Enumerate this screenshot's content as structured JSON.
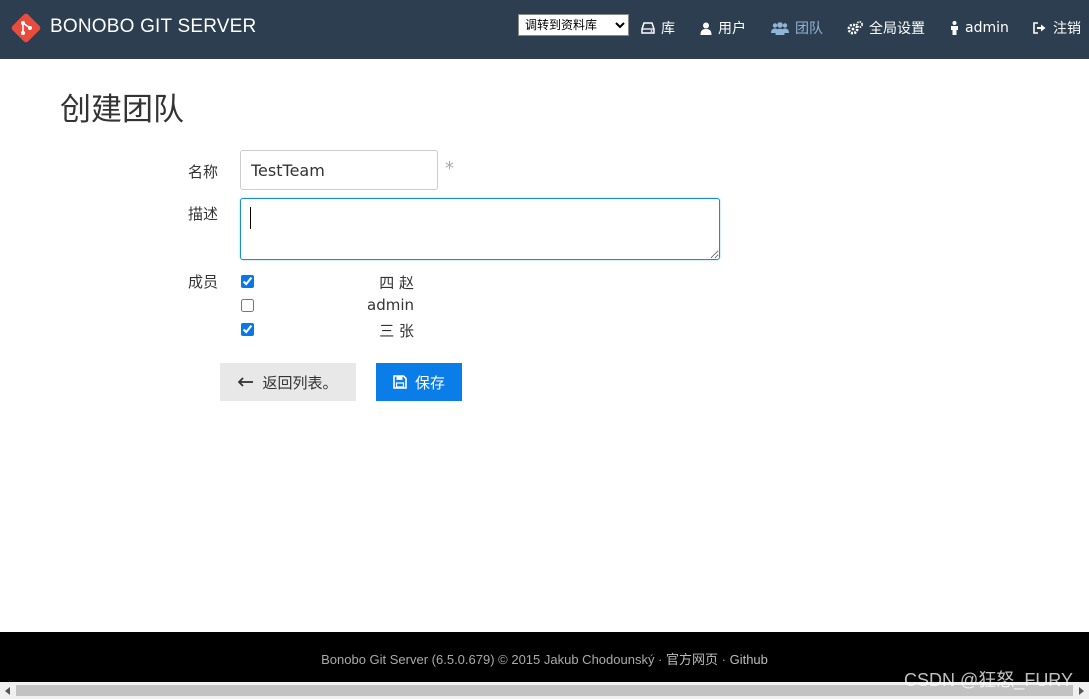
{
  "header": {
    "brand": "BONOBO GIT SERVER",
    "repo_select": {
      "selected": "调转到资料库"
    },
    "nav": [
      {
        "label": "库",
        "icon": "hdd-icon"
      },
      {
        "label": "用户",
        "icon": "user-icon"
      },
      {
        "label": "团队",
        "icon": "team-icon",
        "active": true
      },
      {
        "label": "全局设置",
        "icon": "cogs-icon"
      },
      {
        "label": "admin",
        "icon": "person-icon"
      },
      {
        "label": "注销",
        "icon": "logout-icon"
      }
    ]
  },
  "page": {
    "title": "创建团队"
  },
  "form": {
    "name_label": "名称",
    "name_value": "TestTeam",
    "required_mark": "*",
    "description_label": "描述",
    "description_value": "",
    "members_label": "成员",
    "members": [
      {
        "name": "四 赵",
        "checked": true
      },
      {
        "name": "admin",
        "checked": false
      },
      {
        "name": "三 张",
        "checked": true
      }
    ],
    "back_label": "返回列表。",
    "save_label": "保存"
  },
  "footer": {
    "text": "Bonobo Git Server (6.5.0.679) © 2015 Jakub Chodounský · ",
    "link1": "官方网页",
    "separator": " · ",
    "link2": "Github"
  },
  "watermark": "CSDN @狂怒_FURY",
  "colors": {
    "header_bg": "#2c3e50",
    "accent": "#0a7de8",
    "footer_bg": "#000000",
    "logo": "#e74c3c"
  }
}
